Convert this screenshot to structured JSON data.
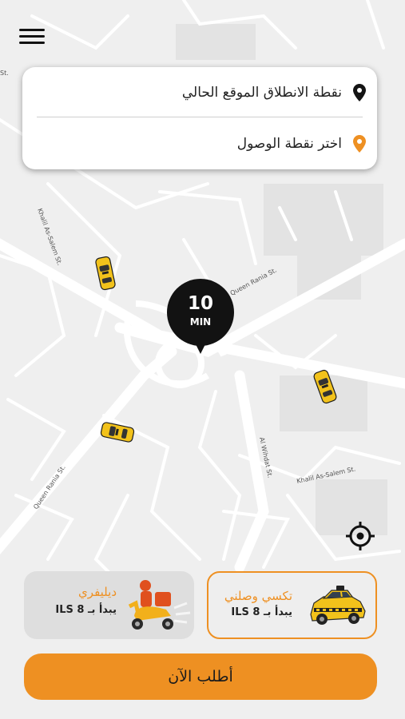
{
  "route": {
    "pickup_label": "نقطة الانطلاق الموقع الحالي",
    "destination_label": "اختر نقطة الوصول"
  },
  "eta": {
    "value": "10",
    "unit": "MIN"
  },
  "map_labels": {
    "st_corner": "St.",
    "khalil_upper": "Khalil As-Salem St.",
    "queen_rania_right": "Queen Rania St.",
    "queen_rania_diag": "Queen Rania St.",
    "al_wihdat": "Al Wihdat St.",
    "khalil_lower": "Khalil As-Salem St."
  },
  "services": [
    {
      "id": "taxi",
      "name": "تكسي وصلني",
      "price": "يبدأ بـ 8 ILS",
      "selected": true
    },
    {
      "id": "delivery",
      "name": "ديليفري",
      "price": "يبدأ بـ 8 ILS",
      "selected": false
    }
  ],
  "order_button": {
    "label": "أطلب الآن"
  },
  "colors": {
    "accent": "#ee9022",
    "pin": "#121212",
    "taxi_yellow": "#f2c21b"
  },
  "icons": {
    "menu": "hamburger-icon",
    "pickup": "map-pin-icon",
    "destination": "map-pin-icon",
    "locate": "crosshair-icon"
  }
}
